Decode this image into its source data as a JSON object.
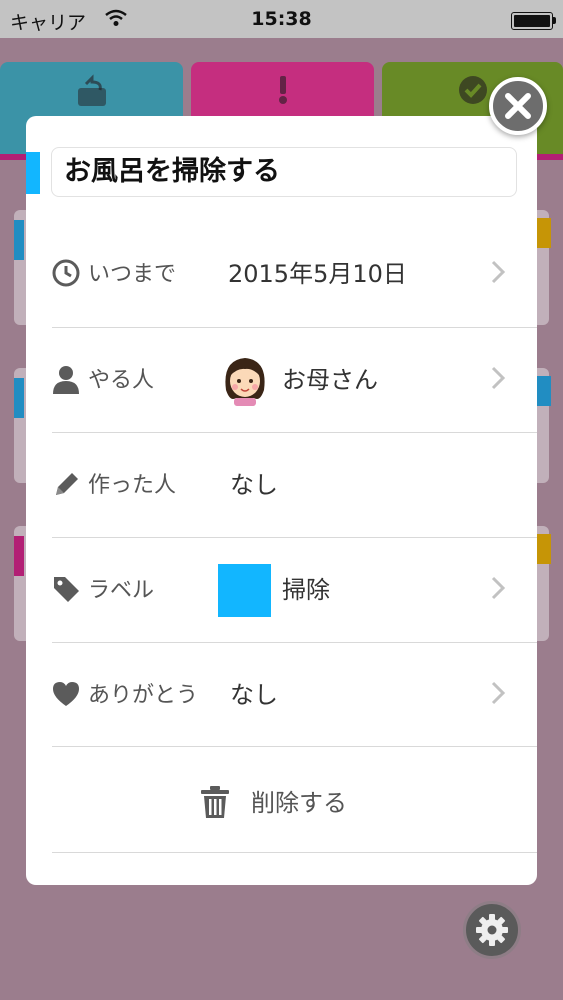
{
  "status_bar": {
    "carrier": "キャリア",
    "time": "15:38",
    "battery_level": 1.0
  },
  "task": {
    "title": "お風呂を掃除する",
    "title_accent_color": "#12b6ff",
    "rows": [
      {
        "label": "いつまで",
        "value": "2015年5月10日",
        "icon": "clock-icon",
        "has_chevron": true
      },
      {
        "label": "やる人",
        "value": "お母さん",
        "icon": "person-icon",
        "avatar": "mother-avatar",
        "has_chevron": true
      },
      {
        "label": "作った人",
        "value": "なし",
        "icon": "pencil-icon",
        "has_chevron": false
      },
      {
        "label": "ラベル",
        "value": "掃除",
        "icon": "tag-icon",
        "label_color": "#12b6ff",
        "has_chevron": true
      },
      {
        "label": "ありがとう",
        "value": "なし",
        "icon": "heart-icon",
        "has_chevron": true
      }
    ],
    "delete_label": "削除する"
  },
  "tabs": [
    {
      "icon": "undo-calendar-icon",
      "color": "#3aa6b8"
    },
    {
      "icon": "exclamation-calendar-icon",
      "color": "#d6338a"
    },
    {
      "icon": "check-calendar-icon",
      "color": "#6d9b25"
    }
  ]
}
